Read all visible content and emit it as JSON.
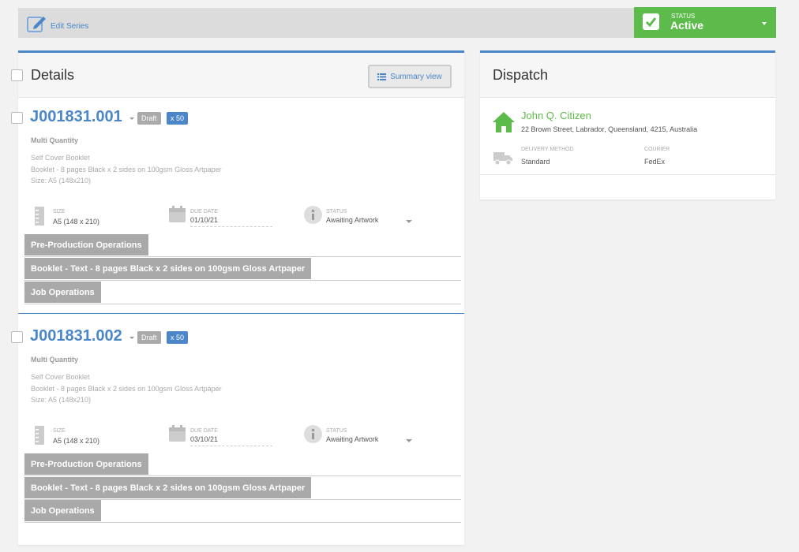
{
  "topbar": {
    "edit_series_label": "Edit Series",
    "status_small": "STATUS",
    "status_value": "Active",
    "status_color": "#5cbb4a"
  },
  "details": {
    "title": "Details",
    "summary_view_label": "Summary view",
    "jobs": [
      {
        "job_number": "J001831.001",
        "badge_draft": "Draft",
        "badge_qty": "x 50",
        "type": "Multi Quantity",
        "desc_line1": "Self Cover Booklet",
        "desc_line2": "Booklet - 8 pages Black x 2 sides on 100gsm Gloss Artpaper",
        "desc_line3": "Size: A5 (148x210)",
        "size_label": "SIZE",
        "size_value": "A5 (148 x 210)",
        "due_label": "DUE DATE",
        "due_value": "01/10/21",
        "status_label": "STATUS",
        "status_value": "Awaiting Artwork",
        "ops": [
          "Pre-Production Operations",
          "Booklet - Text - 8 pages Black x 2 sides on 100gsm Gloss Artpaper",
          "Job Operations"
        ]
      },
      {
        "job_number": "J001831.002",
        "badge_draft": "Draft",
        "badge_qty": "x 50",
        "type": "Multi Quantity",
        "desc_line1": "Self Cover Booklet",
        "desc_line2": "Booklet - 8 pages Black x 2 sides on 100gsm Gloss Artpaper",
        "desc_line3": "Size: A5 (148x210)",
        "size_label": "SIZE",
        "size_value": "A5 (148 x 210)",
        "due_label": "DUE DATE",
        "due_value": "03/10/21",
        "status_label": "STATUS",
        "status_value": "Awaiting Artwork",
        "ops": [
          "Pre-Production Operations",
          "Booklet - Text - 8 pages Black x 2 sides on 100gsm Gloss Artpaper",
          "Job Operations"
        ]
      }
    ]
  },
  "dispatch": {
    "title": "Dispatch",
    "customer_name": "John Q. Citizen",
    "address": "22 Brown Street, Labrador, Queensland, 4215, Australia",
    "delivery_method_label": "DELIVERY METHOD",
    "delivery_method_value": "Standard",
    "courier_label": "COURIER",
    "courier_value": "FedEx"
  },
  "colors": {
    "accent": "#4a86c8",
    "success": "#5cbb4a",
    "operation_bg": "#a9a9a9"
  },
  "icons": [
    "edit-icon",
    "check-icon",
    "list-icon",
    "ruler-icon",
    "calendar-icon",
    "info-icon",
    "house-icon",
    "truck-icon"
  ]
}
